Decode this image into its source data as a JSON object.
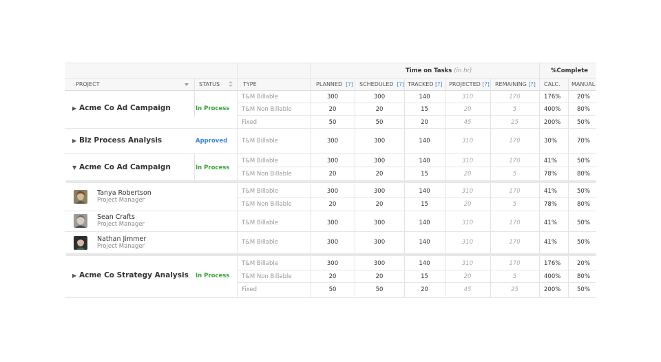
{
  "header": {
    "time_on_tasks": "Time on Tasks",
    "time_unit": "(in hr)",
    "complete": "%Complete",
    "help": "[?]",
    "project": "PROJECT",
    "status": "STATUS",
    "type": "TYPE",
    "planned": "PLANNED",
    "scheduled": "SCHEDULED",
    "tracked": "TRACKED",
    "projected": "PROJECTED",
    "remaining": "REMAINING",
    "calc": "CALC.",
    "manual": "MANUAL"
  },
  "projects": [
    {
      "name": "Acme Co Ad Campaign",
      "status": "In Process",
      "expanded": false
    },
    {
      "name": "Biz Process Analysis",
      "status": "Approved",
      "expanded": false
    },
    {
      "name": "Acme Co Ad Campaign",
      "status": "In Process",
      "expanded": true
    },
    {
      "name": "Acme Co Strategy Analysis",
      "status": "In Process",
      "expanded": false
    }
  ],
  "people": [
    {
      "name": "Tanya Robertson",
      "role": "Project Manager"
    },
    {
      "name": "Sean Crafts",
      "role": "Project Manager"
    },
    {
      "name": "Nathan Jimmer",
      "role": "Project Manager"
    }
  ],
  "rows": [
    {
      "type": "T&M Billable",
      "planned": "300",
      "scheduled": "300",
      "tracked": "140",
      "projected": "310",
      "remaining": "170",
      "calc": "176%",
      "manual": "20%"
    },
    {
      "type": "T&M Non Billable",
      "planned": "20",
      "scheduled": "20",
      "tracked": "15",
      "projected": "20",
      "remaining": "5",
      "calc": "400%",
      "manual": "80%"
    },
    {
      "type": "Fixed",
      "planned": "50",
      "scheduled": "50",
      "tracked": "20",
      "projected": "45",
      "remaining": "25",
      "calc": "200%",
      "manual": "50%"
    },
    {
      "type": "T&M Billable",
      "planned": "300",
      "scheduled": "300",
      "tracked": "140",
      "projected": "310",
      "remaining": "170",
      "calc": "30%",
      "manual": "70%"
    },
    {
      "type": "T&M Billable",
      "planned": "300",
      "scheduled": "300",
      "tracked": "140",
      "projected": "310",
      "remaining": "170",
      "calc": "41%",
      "manual": "50%"
    },
    {
      "type": "T&M Non Billable",
      "planned": "20",
      "scheduled": "20",
      "tracked": "15",
      "projected": "20",
      "remaining": "5",
      "calc": "78%",
      "manual": "80%"
    },
    {
      "type": "T&M Billable",
      "planned": "300",
      "scheduled": "300",
      "tracked": "140",
      "projected": "310",
      "remaining": "170",
      "calc": "41%",
      "manual": "50%"
    },
    {
      "type": "T&M Non Billable",
      "planned": "20",
      "scheduled": "20",
      "tracked": "15",
      "projected": "20",
      "remaining": "5",
      "calc": "78%",
      "manual": "80%"
    },
    {
      "type": "T&M Billable",
      "planned": "300",
      "scheduled": "300",
      "tracked": "140",
      "projected": "310",
      "remaining": "170",
      "calc": "41%",
      "manual": "50%"
    },
    {
      "type": "T&M Billable",
      "planned": "300",
      "scheduled": "300",
      "tracked": "140",
      "projected": "310",
      "remaining": "170",
      "calc": "41%",
      "manual": "50%"
    },
    {
      "type": "T&M Billable",
      "planned": "300",
      "scheduled": "300",
      "tracked": "140",
      "projected": "310",
      "remaining": "170",
      "calc": "176%",
      "manual": "20%"
    },
    {
      "type": "T&M Non Billable",
      "planned": "20",
      "scheduled": "20",
      "tracked": "15",
      "projected": "20",
      "remaining": "5",
      "calc": "400%",
      "manual": "80%"
    },
    {
      "type": "Fixed",
      "planned": "50",
      "scheduled": "50",
      "tracked": "20",
      "projected": "45",
      "remaining": "25",
      "calc": "200%",
      "manual": "50%"
    }
  ],
  "colors": {
    "status_in_process": "#3aa63a",
    "status_approved": "#3f88d3",
    "help_link": "#3f88d3"
  },
  "icons": {
    "collapsed": "caret-right-icon",
    "expanded": "caret-down-icon",
    "project_filter": "dropdown-arrow-icon",
    "status_sort": "sort-icon"
  }
}
